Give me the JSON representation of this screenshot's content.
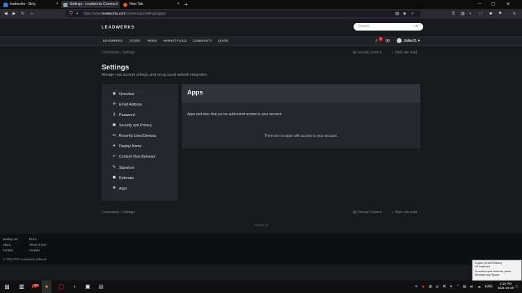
{
  "browser": {
    "tabs": [
      {
        "label": "leadworks - Bing",
        "active": false
      },
      {
        "label": "Settings - Leadworks Commu...",
        "active": true
      },
      {
        "label": "New Tab",
        "active": false
      }
    ],
    "url": {
      "prefix": "https://www.",
      "domain": "leadworks.com",
      "path": "/community/settings/apps/"
    }
  },
  "site": {
    "logo": "LEADWERKS",
    "search_placeholder": "Search",
    "nav": [
      "LEADWERKS",
      "STORE",
      "NEWS",
      "MARKETPLACE",
      "COMMUNITY",
      "LEARN"
    ],
    "notification_count": "1",
    "user": "Jules D."
  },
  "breadcrumb": {
    "root": "Community",
    "current": "Settings"
  },
  "actions": {
    "unread": "Unread Content",
    "mark_read": "Mark site read"
  },
  "page": {
    "title": "Settings",
    "subtitle": "Manage your account settings, and set up social network integration."
  },
  "menu": [
    {
      "label": "Overview",
      "icon": "overview-icon",
      "glyph": "◉"
    },
    {
      "label": "Email Address",
      "icon": "envelope-icon",
      "glyph": "✉"
    },
    {
      "label": "Password",
      "icon": "key-icon",
      "glyph": "⚷"
    },
    {
      "label": "Security and Privacy",
      "icon": "lock-icon",
      "glyph": "▣"
    },
    {
      "label": "Recently Used Devices",
      "icon": "laptop-icon",
      "glyph": "▭"
    },
    {
      "label": "Display Name",
      "icon": "user-icon",
      "glyph": "●"
    },
    {
      "label": "Content View Behavior",
      "icon": "link-icon",
      "glyph": "∞"
    },
    {
      "label": "Signature",
      "icon": "pen-icon",
      "glyph": "✎"
    },
    {
      "label": "Referrals",
      "icon": "users-icon",
      "glyph": "☗"
    },
    {
      "label": "Apps",
      "icon": "cubes-icon",
      "glyph": "❖"
    }
  ],
  "panel": {
    "title": "Apps",
    "description": "Apps and sites that you've authorized access to your account.",
    "empty": "There are no apps with access to your account."
  },
  "theme_label": "Theme ▾",
  "footer": {
    "col1": [
      "Mailing List",
      "About",
      "Contact"
    ],
    "col2": [
      "EULA",
      "Terms of Use",
      "Cookies"
    ],
    "copyright": "© 2006-2020 Leadworks Software"
  },
  "taskbar": {
    "lang": "ENG",
    "time": "3:15 PM",
    "date": "2021-02-25",
    "badge": "99+"
  },
  "tooltip": {
    "line1": "English (United States)",
    "line2": "US keyboard",
    "line3": "To switch input methods, press",
    "line4": "Windows key+Space."
  },
  "colors": {
    "accent": "#e0262c",
    "bg": "#17191c",
    "panel": "#24272b"
  }
}
